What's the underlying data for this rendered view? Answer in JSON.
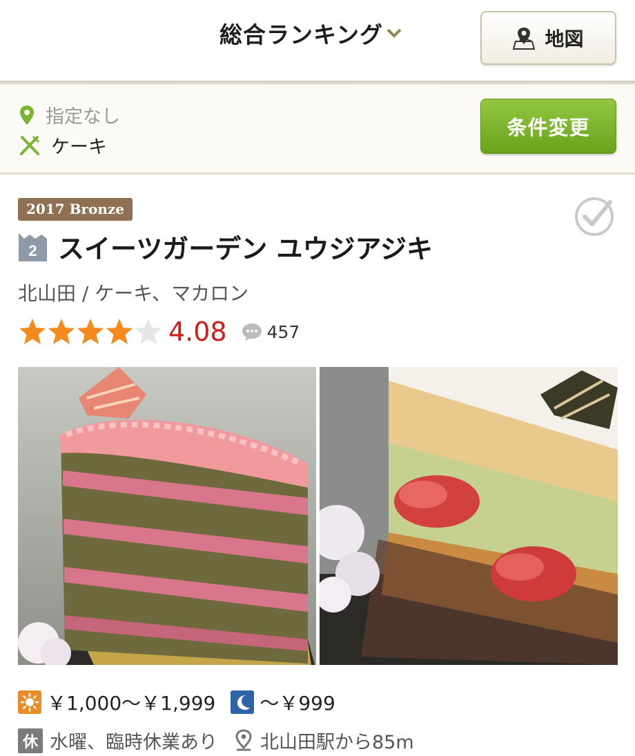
{
  "header": {
    "title": "総合ランキング",
    "map_button": "地図"
  },
  "conditions": {
    "area": "指定なし",
    "genre": "ケーキ",
    "change_button": "条件変更"
  },
  "restaurant": {
    "award_badge": "2017 Bronze",
    "rank": "2",
    "name": "スイーツガーデン ユウジアジキ",
    "area_genre": "北山田 / ケーキ、マカロン",
    "rating": "4.08",
    "stars": 4,
    "review_count": "457",
    "lunch_price": "￥1,000〜￥1,999",
    "dinner_price": "〜￥999",
    "holiday_label": "休",
    "holiday": "水曜、臨時休業あり",
    "access": "北山田駅から85m"
  },
  "colors": {
    "accent_green": "#7ab530",
    "rating_red": "#cc1f1a",
    "star_orange": "#f58a1f",
    "badge_brown": "#8f7052"
  },
  "icons": [
    "chevron-down-icon",
    "map-pin-icon",
    "fork-knife-icon",
    "check-circle-icon",
    "rank-crown-icon",
    "star-icon",
    "comment-icon",
    "sun-icon",
    "moon-icon"
  ]
}
